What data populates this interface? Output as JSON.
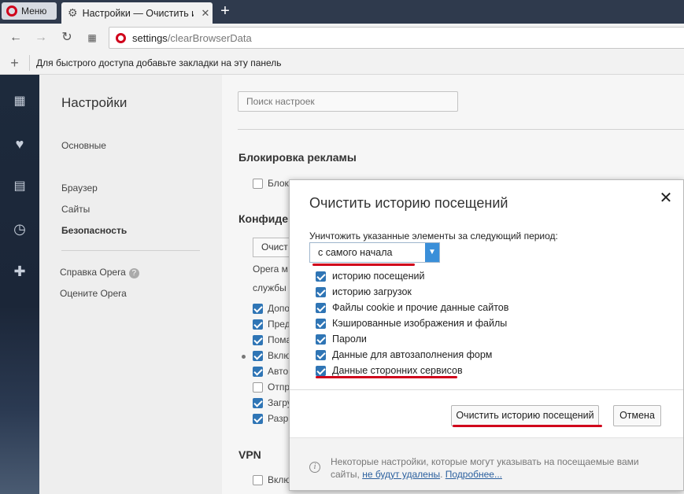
{
  "browser": {
    "menu_label": "Меню",
    "tab_title": "Настройки — Очистить и",
    "new_tab_symbol": "+",
    "address_host": "settings",
    "address_path": "/clearBrowserData",
    "bookmarks_hint": "Для быстрого доступа добавьте закладки на эту панель",
    "bookmarks_add_symbol": "+"
  },
  "sidebar_icons": [
    "speed-dial-icon",
    "heart-icon",
    "news-icon",
    "history-icon",
    "extensions-icon"
  ],
  "settings_nav": {
    "title": "Настройки",
    "items": [
      "Основные",
      "Браузер",
      "Сайты",
      "Безопасность"
    ],
    "active_item": "Безопасность",
    "help": "Справка Opera",
    "rate": "Оцените Opera"
  },
  "main": {
    "search_placeholder": "Поиск настроек",
    "ad_block_heading": "Блокировка рекламы",
    "ad_block_item": "Блок",
    "privacy_heading": "Конфиден",
    "privacy_button": "Очист",
    "privacy_text_1": "Opera м",
    "privacy_text_2": "службы",
    "privacy_items": [
      {
        "label": "Допо",
        "checked": true
      },
      {
        "label": "Пред",
        "checked": true
      },
      {
        "label": "Пома",
        "checked": true
      },
      {
        "label": "Вклю",
        "checked": true
      },
      {
        "label": "Авто",
        "checked": true
      },
      {
        "label": "Отпр",
        "checked": false
      },
      {
        "label": "Загру",
        "checked": true
      },
      {
        "label": "Разр",
        "checked": true
      }
    ],
    "vpn_heading": "VPN",
    "vpn_item": "Вклю"
  },
  "dialog": {
    "title": "Очистить историю посещений",
    "close_symbol": "✕",
    "period_label": "Уничтожить указанные элементы за следующий период:",
    "period_value": "с самого начала",
    "options": [
      {
        "label": "историю посещений",
        "checked": true
      },
      {
        "label": "историю загрузок",
        "checked": true
      },
      {
        "label": "Файлы cookie и прочие данные сайтов",
        "checked": true
      },
      {
        "label": "Кэшированные изображения и файлы",
        "checked": true
      },
      {
        "label": "Пароли",
        "checked": true
      },
      {
        "label": "Данные для автозаполнения форм",
        "checked": true
      },
      {
        "label": "Данные сторонних сервисов",
        "checked": true
      }
    ],
    "clear_button": "Очистить историю посещений",
    "cancel_button": "Отмена",
    "footer_text": "Некоторые настройки, которые могут указывать на посещаемые вами сайты,",
    "footer_link_1": "не будут удалены",
    "footer_link_2": "Подробнее...",
    "annotation_color": "#d0021b"
  }
}
